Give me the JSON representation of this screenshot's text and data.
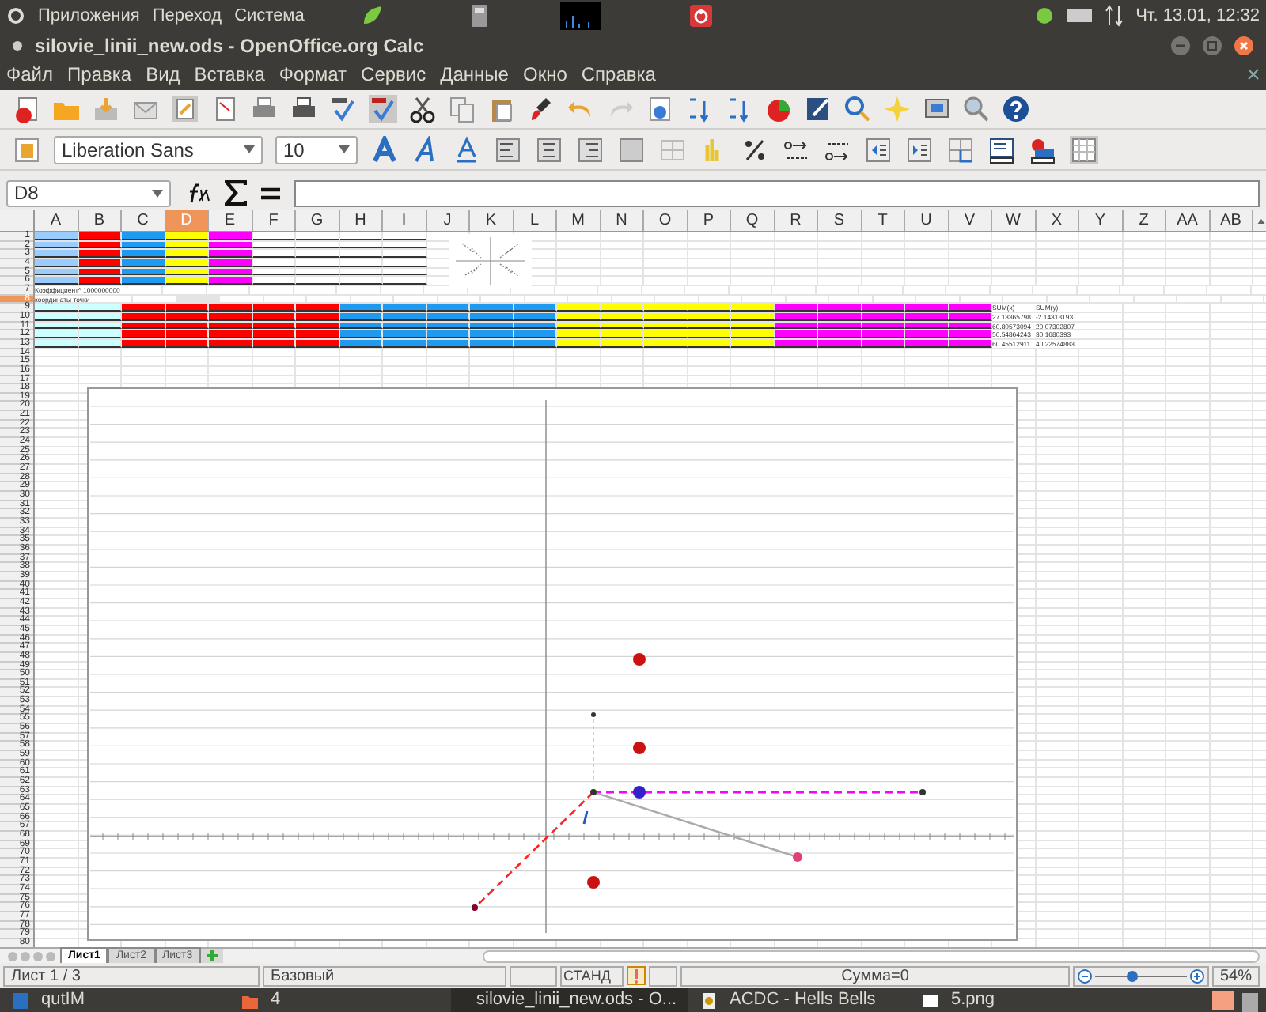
{
  "top_panel": {
    "menus": [
      "Приложения",
      "Переход",
      "Система"
    ],
    "clock": "Чт. 13.01, 12:32"
  },
  "window": {
    "title": "silovie_linii_new.ods - OpenOffice.org Calc"
  },
  "menu": [
    "Файл",
    "Правка",
    "Вид",
    "Вставка",
    "Формат",
    "Сервис",
    "Данные",
    "Окно",
    "Справка"
  ],
  "formatting": {
    "font_name": "Liberation Sans",
    "font_size": "10"
  },
  "formula_bar": {
    "cell_reference": "D8"
  },
  "sheet": {
    "columns": [
      {
        "label": "A",
        "selected": false
      },
      {
        "label": "B",
        "selected": false
      },
      {
        "label": "C",
        "selected": false
      },
      {
        "label": "D",
        "selected": true
      },
      {
        "label": "E",
        "selected": false
      },
      {
        "label": "F",
        "selected": false
      },
      {
        "label": "G",
        "selected": false
      },
      {
        "label": "H",
        "selected": false
      },
      {
        "label": "I",
        "selected": false
      },
      {
        "label": "J",
        "selected": false
      },
      {
        "label": "K",
        "selected": false
      },
      {
        "label": "L",
        "selected": false
      },
      {
        "label": "M",
        "selected": false
      },
      {
        "label": "N",
        "selected": false
      },
      {
        "label": "O",
        "selected": false
      },
      {
        "label": "P",
        "selected": false
      },
      {
        "label": "Q",
        "selected": false
      },
      {
        "label": "R",
        "selected": false
      },
      {
        "label": "S",
        "selected": false
      },
      {
        "label": "T",
        "selected": false
      },
      {
        "label": "U",
        "selected": false
      },
      {
        "label": "V",
        "selected": false
      },
      {
        "label": "W",
        "selected": false
      },
      {
        "label": "X",
        "selected": false
      },
      {
        "label": "Y",
        "selected": false
      },
      {
        "label": "Z",
        "selected": false
      },
      {
        "label": "AA",
        "selected": false
      },
      {
        "label": "AB",
        "selected": false
      }
    ],
    "rows": [
      {
        "label": "1",
        "selected": false,
        "cells": [
          {
            "color": "#99ccff"
          },
          {
            "color": "#ff0000"
          },
          {
            "color": "#1e9bf0"
          },
          {
            "color": "#ffff00"
          },
          {
            "color": "#ff00ff"
          },
          {
            "color": "#ffffff"
          },
          {
            "color": "#ffffff"
          },
          {
            "color": "#ffffff"
          },
          {
            "color": "#ffffff"
          }
        ]
      },
      {
        "label": "2",
        "selected": false,
        "cells": [
          {
            "color": "#99ccff"
          },
          {
            "color": "#ff0000"
          },
          {
            "color": "#1e9bf0"
          },
          {
            "color": "#ffff00"
          },
          {
            "color": "#ff00ff"
          },
          {
            "color": "#ffffff"
          },
          {
            "color": "#ffffff"
          },
          {
            "color": "#ffffff"
          },
          {
            "color": "#ffffff"
          }
        ]
      },
      {
        "label": "3",
        "selected": false,
        "cells": [
          {
            "color": "#99ccff"
          },
          {
            "color": "#ff0000"
          },
          {
            "color": "#1e9bf0"
          },
          {
            "color": "#ffff00"
          },
          {
            "color": "#ff00ff"
          },
          {
            "color": "#ffffff"
          },
          {
            "color": "#ffffff"
          },
          {
            "color": "#ffffff"
          },
          {
            "color": "#ffffff"
          }
        ]
      },
      {
        "label": "4",
        "selected": false,
        "cells": [
          {
            "color": "#99ccff"
          },
          {
            "color": "#ff0000"
          },
          {
            "color": "#1e9bf0"
          },
          {
            "color": "#ffff00"
          },
          {
            "color": "#ff00ff"
          },
          {
            "color": "#ffffff"
          },
          {
            "color": "#ffffff"
          },
          {
            "color": "#ffffff"
          },
          {
            "color": "#ffffff"
          }
        ]
      },
      {
        "label": "5",
        "selected": false,
        "cells": [
          {
            "color": "#99ccff"
          },
          {
            "color": "#ff0000"
          },
          {
            "color": "#1e9bf0"
          },
          {
            "color": "#ffff00"
          },
          {
            "color": "#ff00ff"
          },
          {
            "color": "#ffffff"
          },
          {
            "color": "#ffffff"
          },
          {
            "color": "#ffffff"
          },
          {
            "color": "#ffffff"
          }
        ]
      },
      {
        "label": "6",
        "selected": false,
        "cells": [
          {
            "color": "#99ccff"
          },
          {
            "color": "#ff0000"
          },
          {
            "color": "#1e9bf0"
          },
          {
            "color": "#ffff00"
          },
          {
            "color": "#ff00ff"
          },
          {
            "color": "#ffffff"
          },
          {
            "color": "#ffffff"
          },
          {
            "color": "#ffffff"
          },
          {
            "color": "#ffffff"
          }
        ]
      },
      {
        "label": "7",
        "selected": false,
        "cells": [
          {
            "text": "Коэффициент^ 1000000000"
          }
        ]
      },
      {
        "label": "8",
        "selected": true,
        "cells": [
          {
            "text": "координаты точки"
          },
          {},
          {},
          {
            "active": true
          }
        ]
      },
      {
        "label": "9",
        "selected": false,
        "cells": [
          {
            "color": "#ccffff"
          },
          {
            "color": "#ccffff"
          },
          {
            "color": "#ff0000"
          },
          {
            "color": "#ff0000"
          },
          {
            "color": "#ff0000"
          },
          {
            "color": "#ff0000"
          },
          {
            "color": "#ff0000"
          },
          {
            "color": "#1e9bf0"
          },
          {
            "color": "#1e9bf0"
          },
          {
            "color": "#1e9bf0"
          },
          {
            "color": "#1e9bf0"
          },
          {
            "color": "#1e9bf0"
          },
          {
            "color": "#ffff00"
          },
          {
            "color": "#ffff00"
          },
          {
            "color": "#ffff00"
          },
          {
            "color": "#ffff00"
          },
          {
            "color": "#ffff00"
          },
          {
            "color": "#ff00ff"
          },
          {
            "color": "#ff00ff"
          },
          {
            "color": "#ff00ff"
          },
          {
            "color": "#ff00ff"
          },
          {
            "color": "#ff00ff"
          },
          {
            "text": "SUM(x)"
          },
          {
            "text": "SUM(y)"
          }
        ]
      },
      {
        "label": "10",
        "selected": false,
        "cells": [
          {
            "color": "#ccffff"
          },
          {
            "color": "#ccffff"
          },
          {
            "color": "#ff0000"
          },
          {
            "color": "#ff0000"
          },
          {
            "color": "#ff0000"
          },
          {
            "color": "#ff0000"
          },
          {
            "color": "#ff0000"
          },
          {
            "color": "#1e9bf0"
          },
          {
            "color": "#1e9bf0"
          },
          {
            "color": "#1e9bf0"
          },
          {
            "color": "#1e9bf0"
          },
          {
            "color": "#1e9bf0"
          },
          {
            "color": "#ffff00"
          },
          {
            "color": "#ffff00"
          },
          {
            "color": "#ffff00"
          },
          {
            "color": "#ffff00"
          },
          {
            "color": "#ffff00"
          },
          {
            "color": "#ff00ff"
          },
          {
            "color": "#ff00ff"
          },
          {
            "color": "#ff00ff"
          },
          {
            "color": "#ff00ff"
          },
          {
            "color": "#ff00ff"
          },
          {
            "text": "27.13365798"
          },
          {
            "text": "-2.14318193"
          }
        ]
      },
      {
        "label": "11",
        "selected": false,
        "cells": [
          {
            "color": "#ccffff"
          },
          {
            "color": "#ccffff"
          },
          {
            "color": "#ff0000"
          },
          {
            "color": "#ff0000"
          },
          {
            "color": "#ff0000"
          },
          {
            "color": "#ff0000"
          },
          {
            "color": "#ff0000"
          },
          {
            "color": "#1e9bf0"
          },
          {
            "color": "#1e9bf0"
          },
          {
            "color": "#1e9bf0"
          },
          {
            "color": "#1e9bf0"
          },
          {
            "color": "#1e9bf0"
          },
          {
            "color": "#ffff00"
          },
          {
            "color": "#ffff00"
          },
          {
            "color": "#ffff00"
          },
          {
            "color": "#ffff00"
          },
          {
            "color": "#ffff00"
          },
          {
            "color": "#ff00ff"
          },
          {
            "color": "#ff00ff"
          },
          {
            "color": "#ff00ff"
          },
          {
            "color": "#ff00ff"
          },
          {
            "color": "#ff00ff"
          },
          {
            "text": "60.80573094"
          },
          {
            "text": "20.07302807"
          }
        ]
      },
      {
        "label": "12",
        "selected": false,
        "cells": [
          {
            "color": "#ccffff"
          },
          {
            "color": "#ccffff"
          },
          {
            "color": "#ff0000"
          },
          {
            "color": "#ff0000"
          },
          {
            "color": "#ff0000"
          },
          {
            "color": "#ff0000"
          },
          {
            "color": "#ff0000"
          },
          {
            "color": "#1e9bf0"
          },
          {
            "color": "#1e9bf0"
          },
          {
            "color": "#1e9bf0"
          },
          {
            "color": "#1e9bf0"
          },
          {
            "color": "#1e9bf0"
          },
          {
            "color": "#ffff00"
          },
          {
            "color": "#ffff00"
          },
          {
            "color": "#ffff00"
          },
          {
            "color": "#ffff00"
          },
          {
            "color": "#ffff00"
          },
          {
            "color": "#ff00ff"
          },
          {
            "color": "#ff00ff"
          },
          {
            "color": "#ff00ff"
          },
          {
            "color": "#ff00ff"
          },
          {
            "color": "#ff00ff"
          },
          {
            "text": "50.54864243"
          },
          {
            "text": "30.1680393"
          }
        ]
      },
      {
        "label": "13",
        "selected": false,
        "cells": [
          {
            "color": "#ccffff"
          },
          {
            "color": "#ccffff"
          },
          {
            "color": "#ff0000"
          },
          {
            "color": "#ff0000"
          },
          {
            "color": "#ff0000"
          },
          {
            "color": "#ff0000"
          },
          {
            "color": "#ff0000"
          },
          {
            "color": "#1e9bf0"
          },
          {
            "color": "#1e9bf0"
          },
          {
            "color": "#1e9bf0"
          },
          {
            "color": "#1e9bf0"
          },
          {
            "color": "#1e9bf0"
          },
          {
            "color": "#ffff00"
          },
          {
            "color": "#ffff00"
          },
          {
            "color": "#ffff00"
          },
          {
            "color": "#ffff00"
          },
          {
            "color": "#ffff00"
          },
          {
            "color": "#ff00ff"
          },
          {
            "color": "#ff00ff"
          },
          {
            "color": "#ff00ff"
          },
          {
            "color": "#ff00ff"
          },
          {
            "color": "#ff00ff"
          },
          {
            "text": "60.45512911"
          },
          {
            "text": "40.22574883"
          }
        ]
      },
      {
        "label": "14",
        "selected": false
      },
      {
        "label": "15",
        "selected": false
      },
      {
        "label": "16",
        "selected": false
      },
      {
        "label": "17",
        "selected": false
      },
      {
        "label": "18",
        "selected": false
      },
      {
        "label": "19",
        "selected": false
      },
      {
        "label": "20",
        "selected": false
      },
      {
        "label": "21",
        "selected": false
      },
      {
        "label": "22",
        "selected": false
      },
      {
        "label": "23",
        "selected": false
      },
      {
        "label": "24",
        "selected": false
      },
      {
        "label": "25",
        "selected": false
      },
      {
        "label": "26",
        "selected": false
      },
      {
        "label": "27",
        "selected": false
      },
      {
        "label": "28",
        "selected": false
      },
      {
        "label": "29",
        "selected": false
      },
      {
        "label": "30",
        "selected": false
      },
      {
        "label": "31",
        "selected": false
      },
      {
        "label": "32",
        "selected": false
      },
      {
        "label": "33",
        "selected": false
      },
      {
        "label": "34",
        "selected": false
      },
      {
        "label": "35",
        "selected": false
      },
      {
        "label": "36",
        "selected": false
      },
      {
        "label": "37",
        "selected": false
      },
      {
        "label": "38",
        "selected": false
      },
      {
        "label": "39",
        "selected": false
      },
      {
        "label": "40",
        "selected": false
      },
      {
        "label": "41",
        "selected": false
      },
      {
        "label": "42",
        "selected": false
      },
      {
        "label": "43",
        "selected": false
      },
      {
        "label": "44",
        "selected": false
      },
      {
        "label": "45",
        "selected": false
      },
      {
        "label": "46",
        "selected": false
      },
      {
        "label": "47",
        "selected": false
      },
      {
        "label": "48",
        "selected": false
      },
      {
        "label": "49",
        "selected": false
      },
      {
        "label": "50",
        "selected": false
      },
      {
        "label": "51",
        "selected": false
      },
      {
        "label": "52",
        "selected": false
      },
      {
        "label": "53",
        "selected": false
      },
      {
        "label": "54",
        "selected": false
      },
      {
        "label": "55",
        "selected": false
      },
      {
        "label": "56",
        "selected": false
      },
      {
        "label": "57",
        "selected": false
      },
      {
        "label": "58",
        "selected": false
      },
      {
        "label": "59",
        "selected": false
      },
      {
        "label": "60",
        "selected": false
      },
      {
        "label": "61",
        "selected": false
      },
      {
        "label": "62",
        "selected": false
      },
      {
        "label": "63",
        "selected": false
      },
      {
        "label": "64",
        "selected": false
      },
      {
        "label": "65",
        "selected": false
      },
      {
        "label": "66",
        "selected": false
      },
      {
        "label": "67",
        "selected": false
      },
      {
        "label": "68",
        "selected": false
      },
      {
        "label": "69",
        "selected": false
      },
      {
        "label": "70",
        "selected": false
      },
      {
        "label": "71",
        "selected": false
      },
      {
        "label": "72",
        "selected": false
      },
      {
        "label": "73",
        "selected": false
      },
      {
        "label": "74",
        "selected": false
      },
      {
        "label": "75",
        "selected": false
      },
      {
        "label": "76",
        "selected": false
      },
      {
        "label": "77",
        "selected": false
      },
      {
        "label": "78",
        "selected": false
      },
      {
        "label": "79",
        "selected": false
      },
      {
        "label": "80",
        "selected": false
      }
    ]
  },
  "sheet_tabs": [
    {
      "label": "Лист1",
      "selected": true
    },
    {
      "label": "Лист2",
      "selected": false
    },
    {
      "label": "Лист3",
      "selected": false
    }
  ],
  "status_bar": {
    "sheet": "Лист 1 / 3",
    "page_style": "Базовый",
    "mode": "СТАНД",
    "sum": "Сумма=0",
    "zoom": "54%",
    "zoom_slider": {
      "level": 0.4
    }
  },
  "taskbar": [
    {
      "label": "qutIM",
      "selected": false
    },
    {
      "label": "4",
      "selected": false
    },
    {
      "label": "silovie_linii_new.ods - O...",
      "selected": true
    },
    {
      "label": "ACDC - Hells Bells",
      "selected": false
    },
    {
      "label": "5.png",
      "selected": false
    }
  ]
}
